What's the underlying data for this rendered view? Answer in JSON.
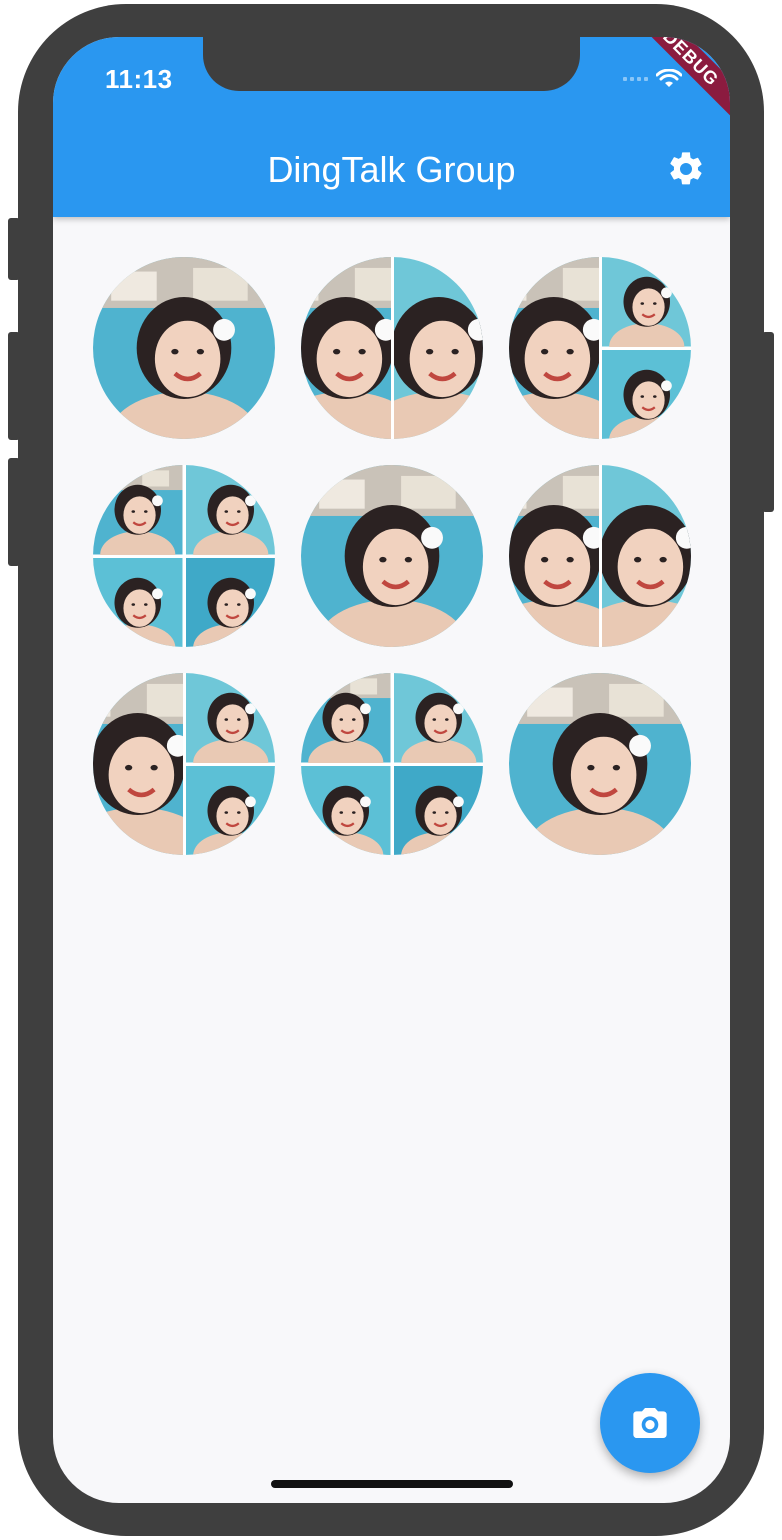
{
  "status_bar": {
    "time": "11:13",
    "debug_label": "DEBUG"
  },
  "app_bar": {
    "title": "DingTalk Group",
    "action_icon": "settings-icon"
  },
  "groups": [
    {
      "photos": [
        "pool-1"
      ]
    },
    {
      "photos": [
        "pool-1",
        "pool-2"
      ]
    },
    {
      "photos": [
        "pool-1",
        "pool-2",
        "pool-3"
      ]
    },
    {
      "photos": [
        "pool-1",
        "pool-2",
        "pool-3",
        "pool-4"
      ]
    },
    {
      "photos": [
        "pool-1"
      ]
    },
    {
      "photos": [
        "pool-1",
        "pool-2"
      ]
    },
    {
      "photos": [
        "pool-1",
        "pool-2",
        "pool-3"
      ]
    },
    {
      "photos": [
        "pool-1",
        "pool-2",
        "pool-3",
        "pool-4"
      ]
    },
    {
      "photos": [
        "pool-1"
      ]
    }
  ],
  "fab": {
    "icon": "camera-icon"
  },
  "colors": {
    "primary": "#2a97f0",
    "background": "#f8f8fa",
    "debug": "#8b1b3f"
  }
}
